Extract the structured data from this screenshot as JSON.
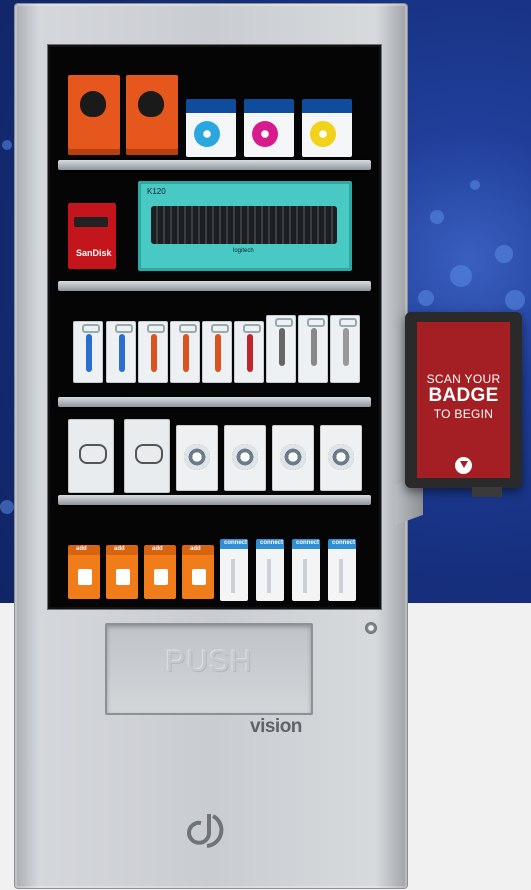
{
  "scene": {
    "brand": "vision",
    "push_label": "PUSH",
    "kiosk": {
      "line1": "SCAN YOUR",
      "line2": "BADGE",
      "line3": "TO BEGIN",
      "icon": "arrow-down-circle-icon",
      "screen_color": "#a31f24"
    },
    "products": {
      "keyboard_model": "K120",
      "keyboard_brand": "logitech",
      "usb_brand": "SanDisk",
      "orange_brand": "add",
      "connect_brand": "connect"
    },
    "colors": {
      "background_blue": "#1a3b92",
      "machine_silver": "#cfd2d6",
      "window_black": "#050505"
    }
  }
}
